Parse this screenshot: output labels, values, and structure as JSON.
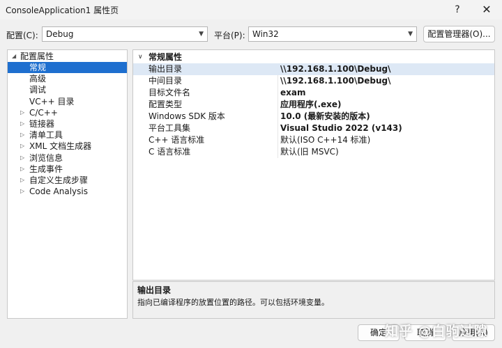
{
  "window": {
    "title": "ConsoleApplication1 属性页",
    "help": "?",
    "close": "✕"
  },
  "toolbar": {
    "config_label": "配置(C):",
    "config_value": "Debug",
    "platform_label": "平台(P):",
    "platform_value": "Win32",
    "config_manager": "配置管理器(O)..."
  },
  "tree": {
    "root": "配置属性",
    "items": [
      {
        "label": "常规",
        "selected": true,
        "expandable": false
      },
      {
        "label": "高级",
        "expandable": false
      },
      {
        "label": "调试",
        "expandable": false
      },
      {
        "label": "VC++ 目录",
        "expandable": false
      },
      {
        "label": "C/C++",
        "expandable": true
      },
      {
        "label": "链接器",
        "expandable": true
      },
      {
        "label": "清单工具",
        "expandable": true
      },
      {
        "label": "XML 文档生成器",
        "expandable": true
      },
      {
        "label": "浏览信息",
        "expandable": true
      },
      {
        "label": "生成事件",
        "expandable": true
      },
      {
        "label": "自定义生成步骤",
        "expandable": true
      },
      {
        "label": "Code Analysis",
        "expandable": true
      }
    ]
  },
  "grid": {
    "category": "常规属性",
    "rows": [
      {
        "name": "输出目录",
        "value": "\\\\192.168.1.100\\Debug\\",
        "bold": true
      },
      {
        "name": "中间目录",
        "value": "\\\\192.168.1.100\\Debug\\",
        "bold": true
      },
      {
        "name": "目标文件名",
        "value": "exam",
        "bold": true
      },
      {
        "name": "配置类型",
        "value": "应用程序(.exe)",
        "bold": true
      },
      {
        "name": "Windows SDK 版本",
        "value": "10.0 (最新安装的版本)",
        "bold": true
      },
      {
        "name": "平台工具集",
        "value": "Visual Studio 2022 (v143)",
        "bold": true
      },
      {
        "name": "C++ 语言标准",
        "value": "默认(ISO C++14 标准)",
        "bold": false
      },
      {
        "name": "C 语言标准",
        "value": "默认(旧 MSVC)",
        "bold": false
      }
    ]
  },
  "description": {
    "title": "输出目录",
    "text": "指向已编译程序的放置位置的路径。可以包括环境变量。"
  },
  "footer": {
    "ok": "确定",
    "cancel": "取消",
    "apply": "应用(A)"
  },
  "watermark": "知乎 @白驹过隙"
}
